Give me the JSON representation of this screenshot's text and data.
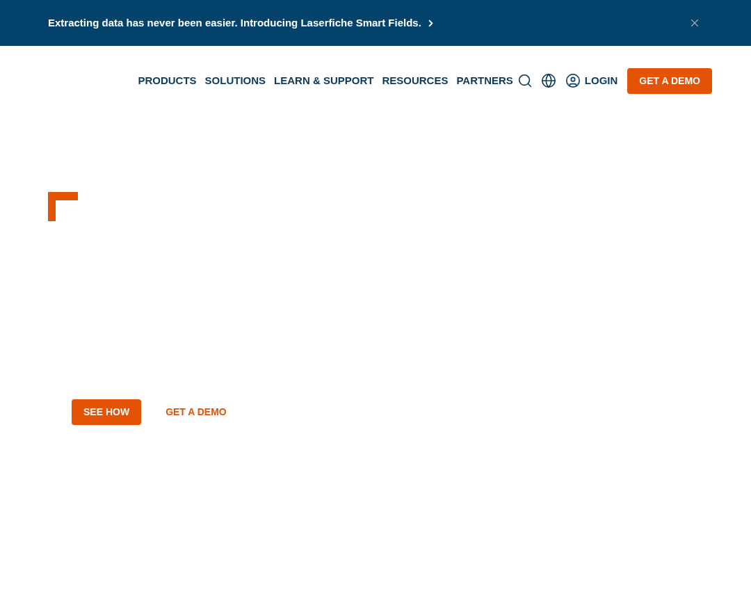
{
  "announcement": {
    "text": "Extracting data has never been easier. Introducing Laserfiche Smart Fields."
  },
  "nav": {
    "items": [
      {
        "label": "PRODUCTS"
      },
      {
        "label": "SOLUTIONS"
      },
      {
        "label": "LEARN & SUPPORT"
      },
      {
        "label": "RESOURCES"
      },
      {
        "label": "PARTNERS"
      }
    ],
    "login": "LOGIN",
    "cta": "GET A DEMO"
  },
  "hero": {
    "buttons": [
      {
        "label": "SEE HOW",
        "kind": "primary"
      },
      {
        "label": "GET A DEMO",
        "kind": "link"
      }
    ]
  }
}
